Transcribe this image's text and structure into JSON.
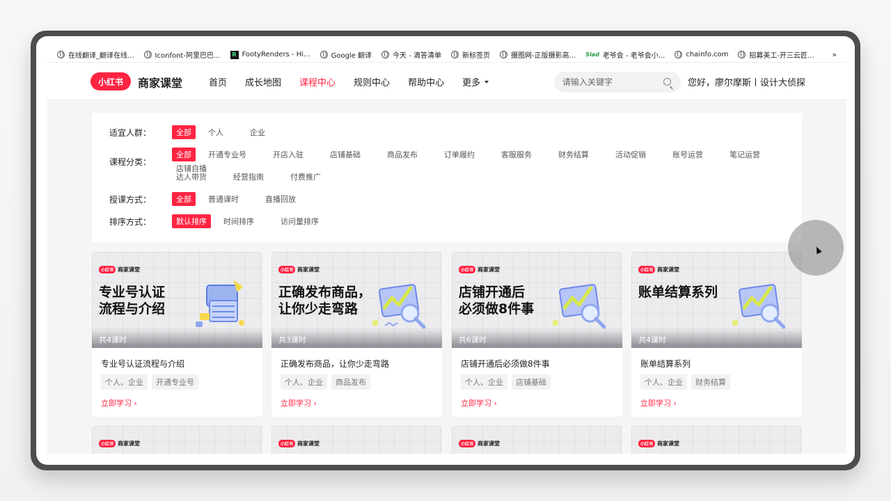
{
  "bookmarks": [
    {
      "label": "在线翻译_翻译在线...",
      "icon": "globe-icon"
    },
    {
      "label": "Iconfont-阿里巴巴...",
      "icon": "globe-icon"
    },
    {
      "label": "FootyRenders - Hi...",
      "icon": "fr-favicon"
    },
    {
      "label": "Google 翻译",
      "icon": "globe-icon"
    },
    {
      "label": "今天 - 滴答清单",
      "icon": "globe-icon"
    },
    {
      "label": "新标签页",
      "icon": "globe-icon"
    },
    {
      "label": "摄图网-正版摄影高...",
      "icon": "globe-icon"
    },
    {
      "label": "老爷会 - 老爷会小...",
      "icon": "slad-favicon"
    },
    {
      "label": "chainfo.com",
      "icon": "globe-icon"
    },
    {
      "label": "招募美工-开三云匠...",
      "icon": "globe-icon"
    }
  ],
  "bookmarks_more": "»",
  "header": {
    "logo": "小红书",
    "site_name": "商家课堂",
    "nav": [
      "首页",
      "成长地图",
      "课程中心",
      "规则中心",
      "帮助中心",
      "更多"
    ],
    "active_nav": "课程中心",
    "search_placeholder": "请输入关键字",
    "greeting": "您好，廖尔摩斯丨设计大侦探"
  },
  "filters": {
    "audience": {
      "label": "适宜人群：",
      "options": [
        "全部",
        "个人",
        "企业"
      ]
    },
    "category": {
      "label": "课程分类：",
      "options": [
        "全部",
        "开通专业号",
        "开店入驻",
        "店铺基础",
        "商品发布",
        "订单履约",
        "客服服务",
        "财务结算",
        "活动促销",
        "账号运营",
        "笔记运营",
        "店铺自播"
      ],
      "options_row2": [
        "达人带货",
        "经营指南",
        "付费推广"
      ]
    },
    "method": {
      "label": "授课方式：",
      "options": [
        "全部",
        "普通课时",
        "直播回放"
      ]
    },
    "sort": {
      "label": "排序方式：",
      "options": [
        "默认排序",
        "时间排序",
        "访问量排序"
      ]
    }
  },
  "courses": [
    {
      "thumb_title": "专业号认证\n流程与介绍",
      "lessons": "共4课时",
      "title": "专业号认证流程与介绍",
      "tags": [
        "个人、企业",
        "开通专业号"
      ],
      "cta": "立即学习 ›"
    },
    {
      "thumb_title": "正确发布商品，\n让你少走弯路",
      "lessons": "共3课时",
      "title": "正确发布商品，让你少走弯路",
      "tags": [
        "个人、企业",
        "商品发布"
      ],
      "cta": "立即学习 ›"
    },
    {
      "thumb_title": "店铺开通后\n必须做8件事",
      "lessons": "共6课时",
      "title": "店铺开通后必须做8件事",
      "tags": [
        "个人、企业",
        "店铺基础"
      ],
      "cta": "立即学习 ›"
    },
    {
      "thumb_title": "账单结算系列",
      "lessons": "共4课时",
      "title": "账单结算系列",
      "tags": [
        "个人、企业",
        "财务结算"
      ],
      "cta": "立即学习 ›"
    }
  ],
  "thumb_brand": {
    "pill": "小红书",
    "name": "商家课堂"
  },
  "colors": {
    "accent": "#ff2442"
  }
}
